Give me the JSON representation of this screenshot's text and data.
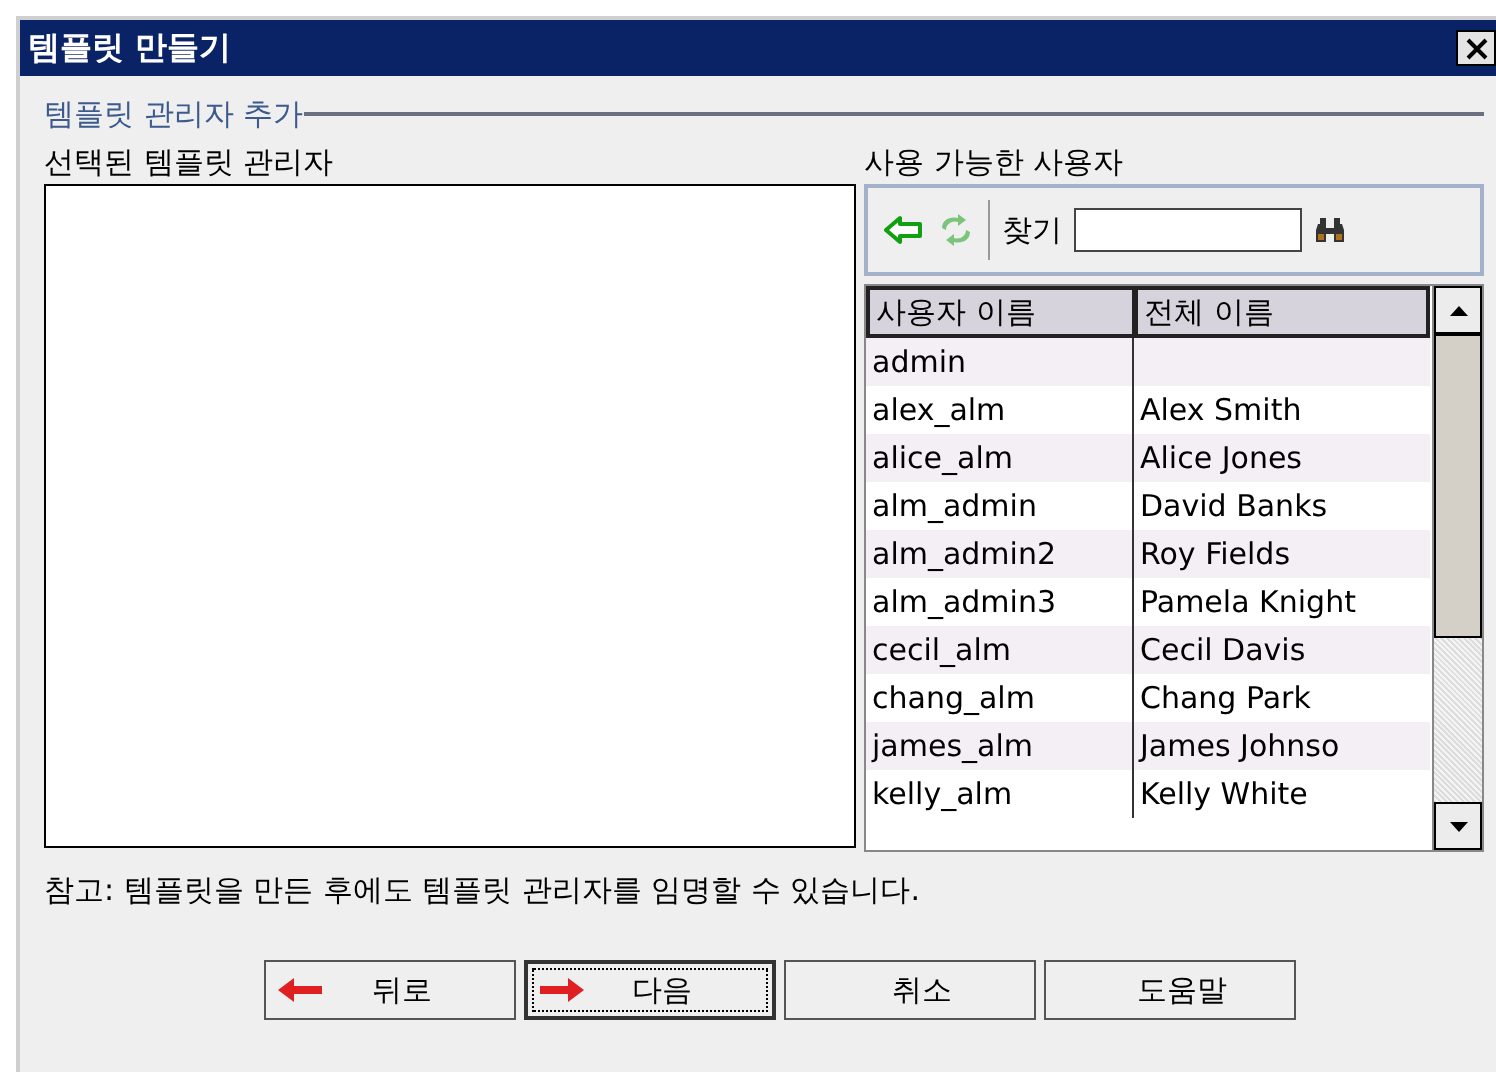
{
  "window": {
    "title": "템플릿 만들기"
  },
  "group": {
    "title": "템플릿 관리자 추가"
  },
  "selected_panel": {
    "label": "선택된 템플릿 관리자"
  },
  "available_panel": {
    "label": "사용 가능한 사용자",
    "search_label": "찾기",
    "table": {
      "columns": [
        "사용자 이름",
        "전체 이름"
      ],
      "rows": [
        {
          "user": "admin",
          "full_name": ""
        },
        {
          "user": "alex_alm",
          "full_name": "Alex Smith"
        },
        {
          "user": "alice_alm",
          "full_name": "Alice Jones"
        },
        {
          "user": "alm_admin",
          "full_name": "David Banks"
        },
        {
          "user": "alm_admin2",
          "full_name": "Roy Fields"
        },
        {
          "user": "alm_admin3",
          "full_name": "Pamela Knight"
        },
        {
          "user": "cecil_alm",
          "full_name": "Cecil Davis"
        },
        {
          "user": "chang_alm",
          "full_name": "Chang Park"
        },
        {
          "user": "james_alm",
          "full_name": "James Johnso"
        },
        {
          "user": "kelly_alm",
          "full_name": "Kelly White"
        }
      ]
    }
  },
  "note": "참고: 템플릿을 만든 후에도 템플릿 관리자를 임명할 수 있습니다.",
  "buttons": [
    {
      "label": "뒤로",
      "kind": "back",
      "default": false
    },
    {
      "label": "다음",
      "kind": "next",
      "default": true
    },
    {
      "label": "취소",
      "kind": "plain",
      "default": false
    },
    {
      "label": "도움말",
      "kind": "plain",
      "default": false
    }
  ]
}
